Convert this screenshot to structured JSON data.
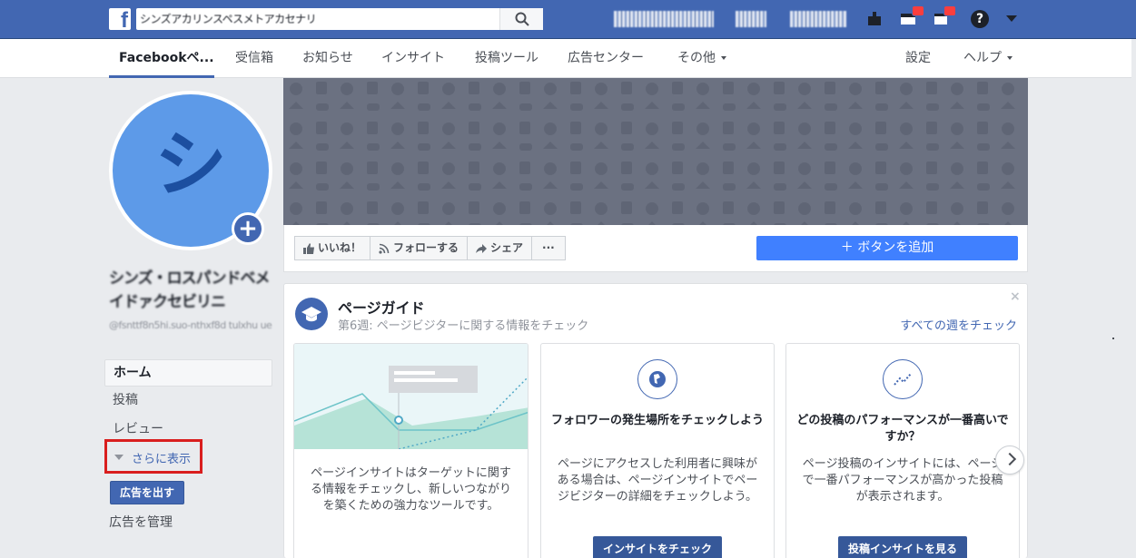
{
  "topbar": {
    "search_value": "シンズアカリンスペスメトアカセナリ",
    "search_icon": "search-icon",
    "help_icon": "question-mark-icon"
  },
  "subnav": {
    "items": [
      "Facebookペ...",
      "受信箱",
      "お知らせ",
      "インサイト",
      "投稿ツール",
      "広告センター",
      "その他"
    ],
    "settings": "設定",
    "help": "ヘルプ"
  },
  "profile": {
    "avatar_letter": "シ",
    "name": "シンズ・ロスパンドベメイドァクセビリニ",
    "handle": "@fsnttf8n5hi.suo-nthxf8d tulxhu ue"
  },
  "left_nav": {
    "home": "ホーム",
    "posts": "投稿",
    "reviews": "レビュー",
    "more": "さらに表示",
    "create_ad": "広告を出す",
    "manage_ads": "広告を管理"
  },
  "actions": {
    "like": "いいね！",
    "follow": "フォローする",
    "share": "シェア",
    "more": "···",
    "add_button": "＋ ボタンを追加"
  },
  "guide": {
    "title": "ページガイド",
    "subtitle": "第6週: ページビジターに関する情報をチェック",
    "see_all": "すべての週をチェック",
    "close": "×",
    "cards": [
      {
        "text": "ページインサイトはターゲットに関する情報をチェックし、新しいつながりを築くための強力なツールです。"
      },
      {
        "title": "フォロワーの発生場所をチェックしよう",
        "text": "ページにアクセスした利用者に興味がある場合は、ページインサイトでページビジターの詳細をチェックしよう。",
        "button": "インサイトをチェック",
        "icon": "globe-icon"
      },
      {
        "title": "どの投稿のパフォーマンスが一番高いですか？",
        "text": "ページ投稿のインサイトには、ページで一番パフォーマンスが高かった投稿が表示されます。",
        "button": "投稿インサイトを見る",
        "icon": "trend-line-icon"
      }
    ]
  },
  "colors": {
    "brand": "#4267b2",
    "add_button": "#4080ff",
    "highlight_border": "#d91e1e"
  }
}
